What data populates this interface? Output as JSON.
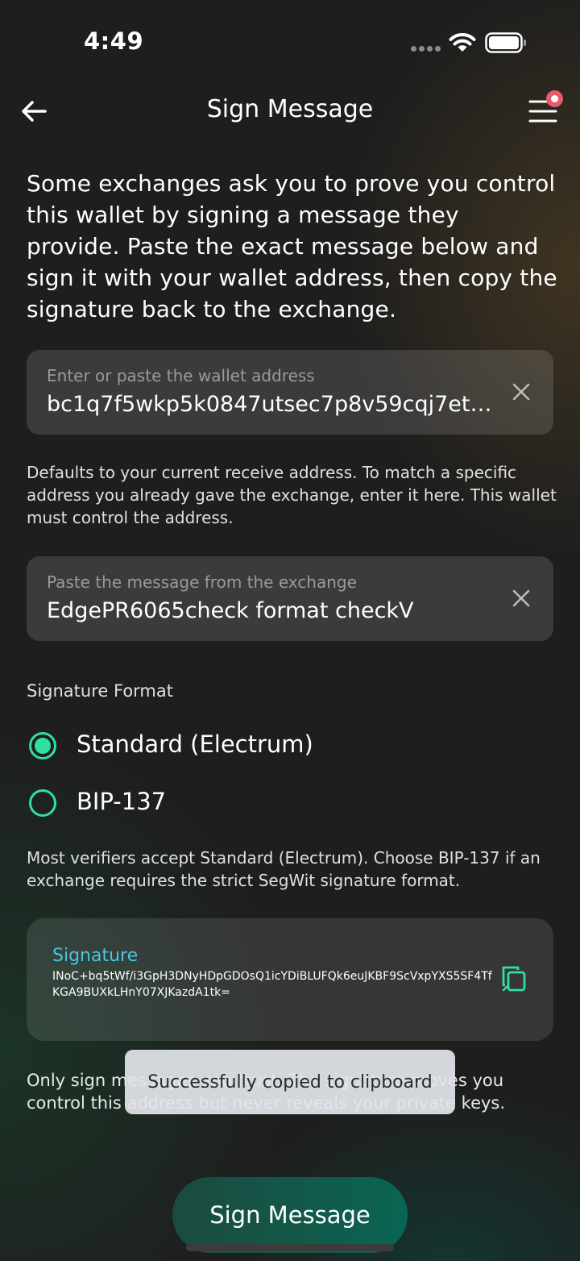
{
  "status_bar": {
    "time": "4:49"
  },
  "header": {
    "title": "Sign Message"
  },
  "intro": "Some exchanges ask you to prove you control this wallet by signing a message they provide. Paste the exact message below and sign it with your wallet address, then copy the signature back to the exchange.",
  "address_field": {
    "placeholder": "Enter or paste the wallet address",
    "value": "bc1q7f5wkp5k0847utsec7p8v59cqj7et6..."
  },
  "address_help": "Defaults to your current receive address. To match a specific address you already gave the exchange, enter it here. This wallet must control the address.",
  "message_field": {
    "placeholder": "Paste the message from the exchange",
    "value": "EdgePR6065check format checkV"
  },
  "signature_format": {
    "label": "Signature Format",
    "options": [
      {
        "label": "Standard (Electrum)",
        "selected": true
      },
      {
        "label": "BIP-137",
        "selected": false
      }
    ],
    "help": "Most verifiers accept Standard (Electrum). Choose BIP-137 if an exchange requires the strict SegWit signature format."
  },
  "signature": {
    "title": "Signature",
    "value": "INoC+bq5tWf/i3GpH3DNyHDpGDOsQ1icYDiBLUFQk6euJKBF9ScVxpYXS5SF4TfKGA9BUXkLHnY07XJKazdA1tk="
  },
  "footer_text": "Only sign messages you trust. The signature proves you control this address but never reveals your private keys.",
  "toast": "Successfully copied to clipboard",
  "cta": "Sign Message",
  "colors": {
    "accent": "#2fe0a0",
    "signature_title": "#4cc5e0",
    "badge": "#e85b6a",
    "cta": "#0a6552"
  }
}
